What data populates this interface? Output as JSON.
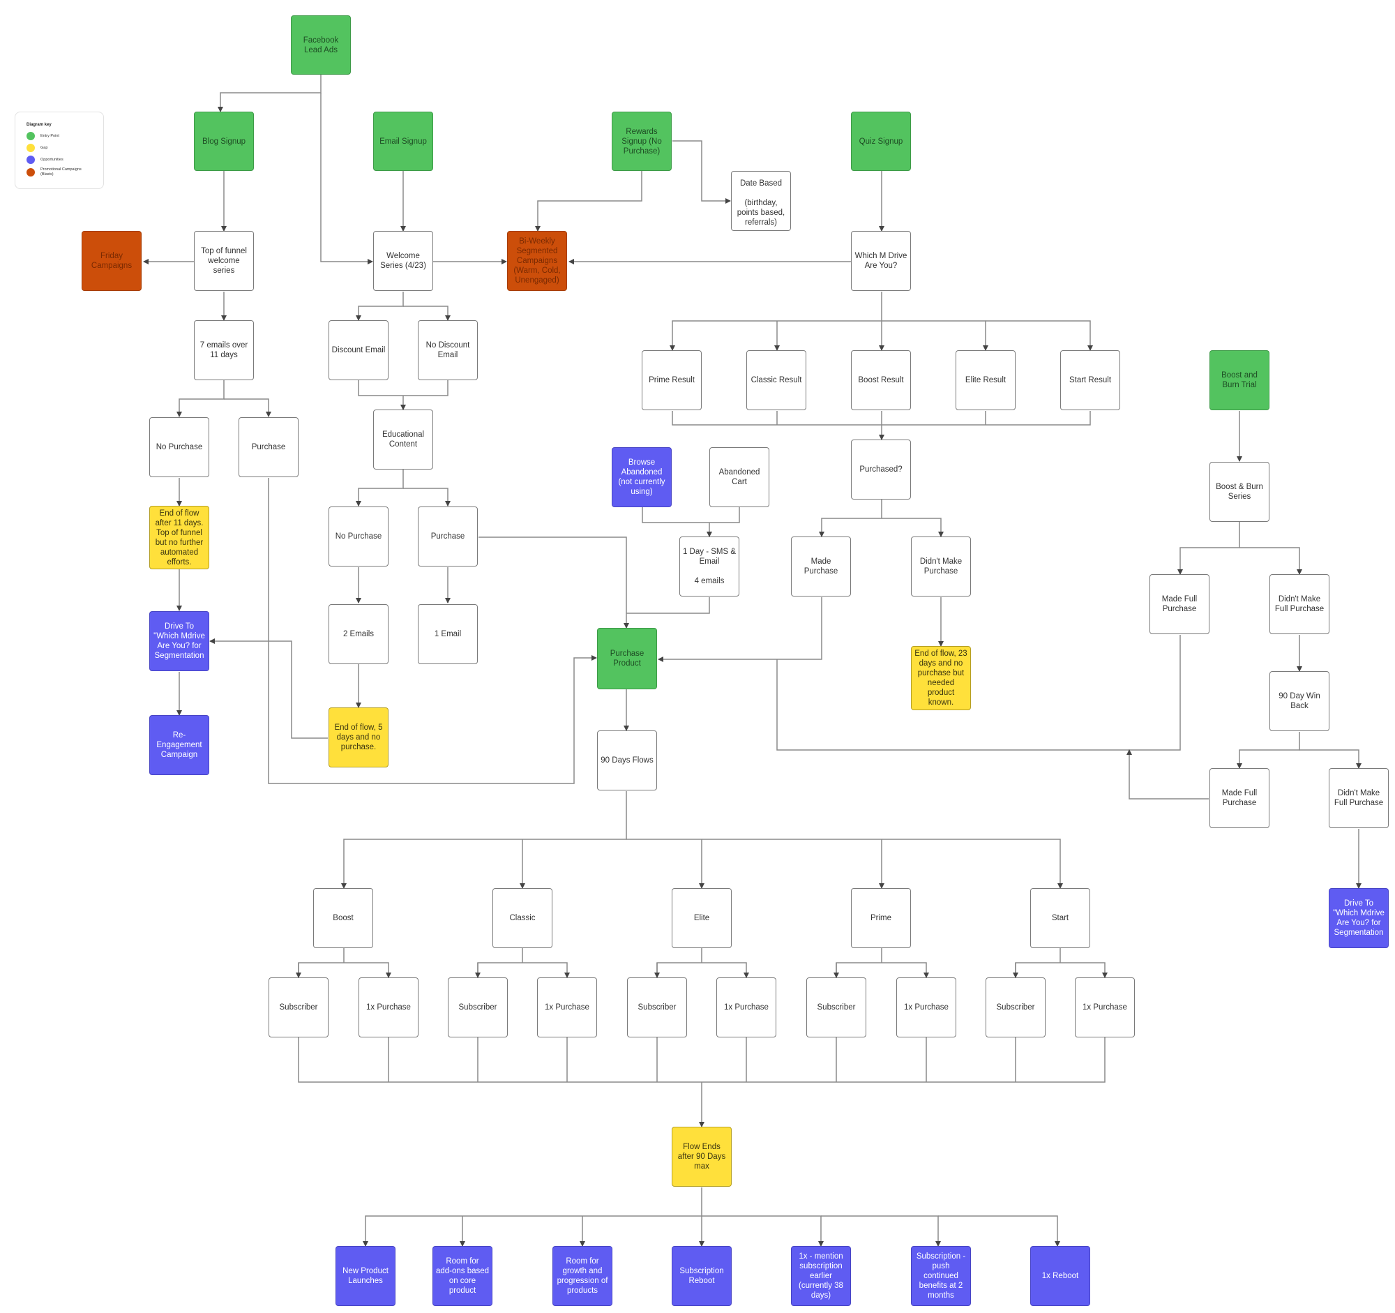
{
  "legend": {
    "title": "Diagram key",
    "items": [
      {
        "label": "Entry Point",
        "color": "#53c35f"
      },
      {
        "label": "Gap",
        "color": "#ffe03b"
      },
      {
        "label": "Opportunities",
        "color": "#5f5cf2"
      },
      {
        "label": "Promotional Campaigns (Blasts)",
        "color": "#cc4e0a"
      }
    ]
  },
  "nodes": {
    "facebook_lead_ads": "Facebook\nLead Ads",
    "blog_signup": "Blog Signup",
    "email_signup": "Email Signup",
    "rewards_signup": "Rewards\nSignup (No\nPurchase)",
    "quiz_signup": "Quiz Signup",
    "date_based": "Date Based\n\n(birthday,\npoints based,\nreferrals)",
    "friday_campaigns": "Friday\nCampaigns",
    "top_of_funnel": "Top of funnel\nwelcome\nseries",
    "welcome_series": "Welcome\nSeries (4/23)",
    "biweekly": "Bi-Weekly\nSegmented\nCampaigns\n(Warm, Cold,\nUnengaged)",
    "which_m_drive": "Which M Drive\nAre You?",
    "seven_emails": "7 emails  over\n11 days",
    "discount_email": "Discount Email",
    "no_discount_email": "No Discount\nEmail",
    "prime_result": "Prime Result",
    "classic_result": "Classic Result",
    "boost_result": "Boost Result",
    "elite_result": "Elite Result",
    "start_result": "Start Result",
    "boost_burn_trial": "Boost and\nBurn Trial",
    "no_purchase_1": "No Purchase",
    "purchase_1": "Purchase",
    "educational_content": "Educational\nContent",
    "browse_abandoned": "Browse\nAbandoned\n(not currently\nusing)",
    "abandoned_cart": "Abandoned\nCart",
    "purchased_q": "Purchased?",
    "boost_burn_series": "Boost & Burn\nSeries",
    "end_flow_11": "End of flow\nafter 11 days.\nTop of funnel\nbut no further\nautomated\nefforts.",
    "no_purchase_2": "No Purchase",
    "purchase_2": "Purchase",
    "one_day_sms": "1 Day - SMS &\nEmail\n\n4 emails",
    "made_purchase": "Made\nPurchase",
    "didnt_make_purchase": "Didn't Make\nPurchase",
    "made_full_purchase_1": "Made Full\nPurchase",
    "didnt_make_full_1": "Didn't Make\nFull Purchase",
    "drive_to_which_1": "Drive To\n\"Which Mdrive\nAre You? for\nSegmentation",
    "two_emails": "2 Emails",
    "one_email": "1 Email",
    "purchase_product": "Purchase\nProduct",
    "end_flow_23": "End of flow, 23\ndays and no\npurchase but\nneeded\nproduct\nknown.",
    "ninety_day_winback": "90 Day Win\nBack",
    "re_engagement": "Re-Engagement\nCampaign",
    "end_flow_5": "End of flow, 5\ndays and no\npurchase.",
    "ninety_days_flows": "90 Days Flows",
    "made_full_purchase_2": "Made Full\nPurchase",
    "didnt_make_full_2": "Didn't Make\nFull Purchase",
    "boost": "Boost",
    "classic": "Classic",
    "elite": "Elite",
    "prime": "Prime",
    "start": "Start",
    "drive_to_which_2": "Drive To\n\"Which Mdrive\nAre You? for\nSegmentation",
    "boost_subscriber": "Subscriber",
    "boost_1x": "1x Purchase",
    "classic_subscriber": "Subscriber",
    "classic_1x": "1x Purchase",
    "elite_subscriber": "Subscriber",
    "elite_1x": "1x Purchase",
    "prime_subscriber": "Subscriber",
    "prime_1x": "1x Purchase",
    "start_subscriber": "Subscriber",
    "start_1x": "1x Purchase",
    "flow_ends": "Flow Ends\nafter 90 Days\nmax",
    "new_product_launches": "New Product\nLaunches",
    "room_addons": "Room for\nadd-ons based\non core\nproduct",
    "room_growth": "Room for\ngrowth and\nprogression of\nproducts",
    "subscription_reboot": "Subscription\nReboot",
    "mention_subscription": "1x - mention\nsubscription\nearlier\n(currently 38\ndays)",
    "subscription_push": "Subscription -\npush\ncontinued\nbenefits at 2\nmonths",
    "one_x_reboot": "1x Reboot"
  }
}
